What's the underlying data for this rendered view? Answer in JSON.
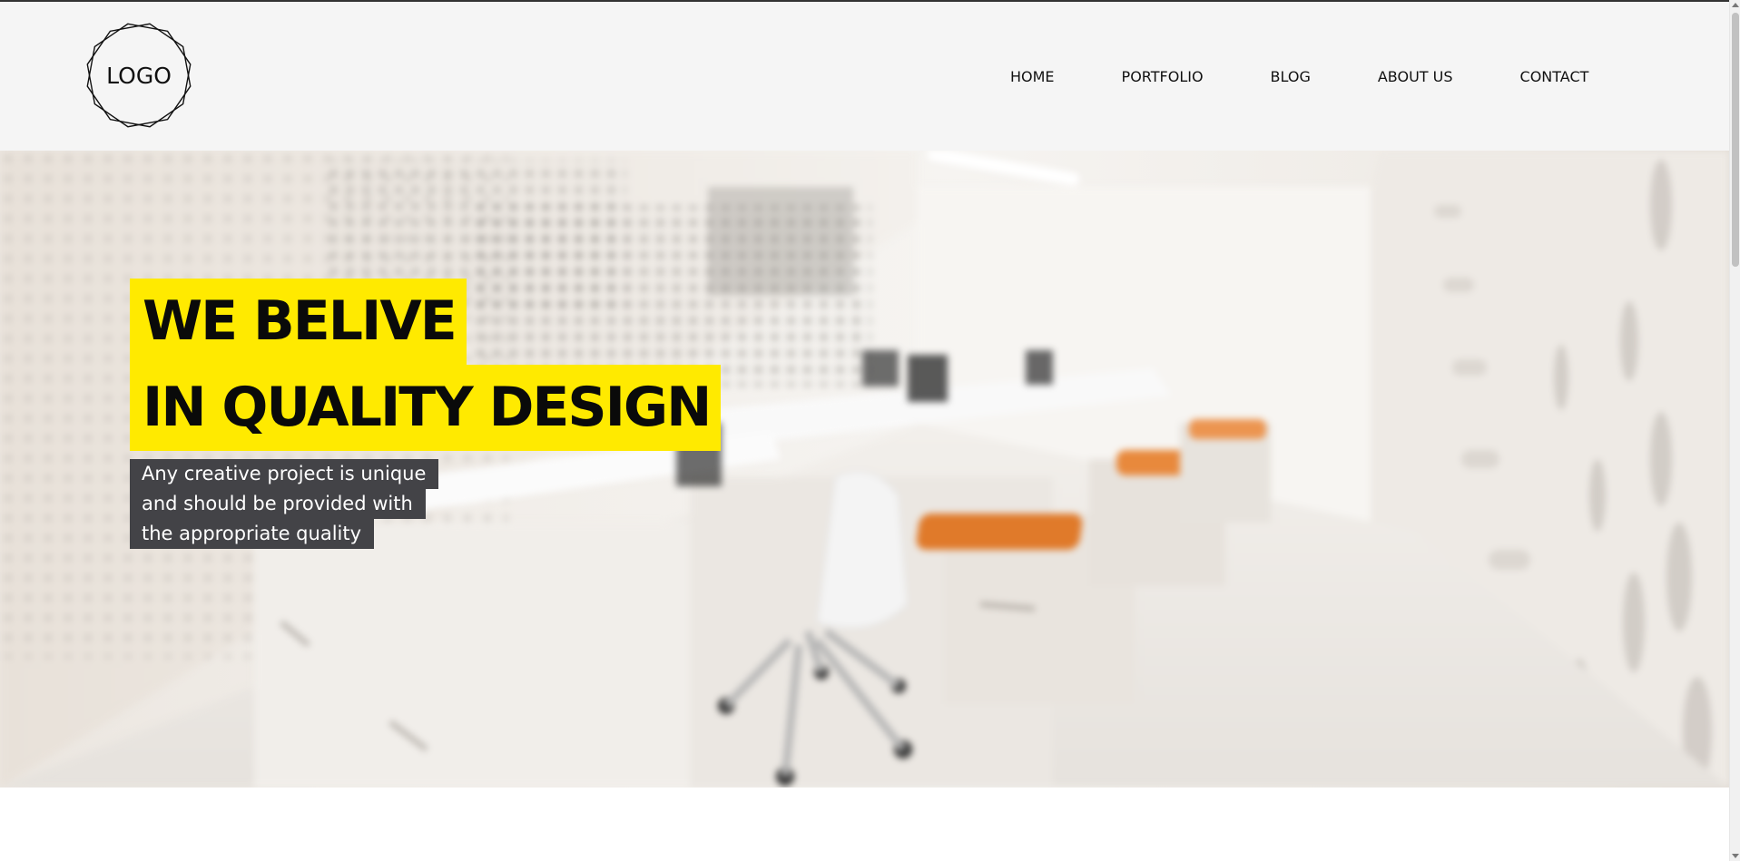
{
  "logo": {
    "text": "LOGO",
    "icon": "octagram-badge-icon"
  },
  "nav": {
    "items": [
      {
        "label": "HOME"
      },
      {
        "label": "PORTFOLIO"
      },
      {
        "label": "BLOG"
      },
      {
        "label": "ABOUT US"
      },
      {
        "label": "CONTACT"
      }
    ]
  },
  "hero": {
    "headline_lines": [
      "WE BELIVE",
      "IN QUALITY DESIGN"
    ],
    "subtext_lines": [
      "Any creative project is unique",
      "and should be provided with",
      "the appropriate quality"
    ],
    "image": "blurred-office-interior"
  },
  "colors": {
    "header_bg": "#f5f5f5",
    "headline_highlight": "#ffea00",
    "subtext_bg": "#434347",
    "text_dark": "#0a0a0a",
    "accent_orange": "#e07a2a"
  }
}
